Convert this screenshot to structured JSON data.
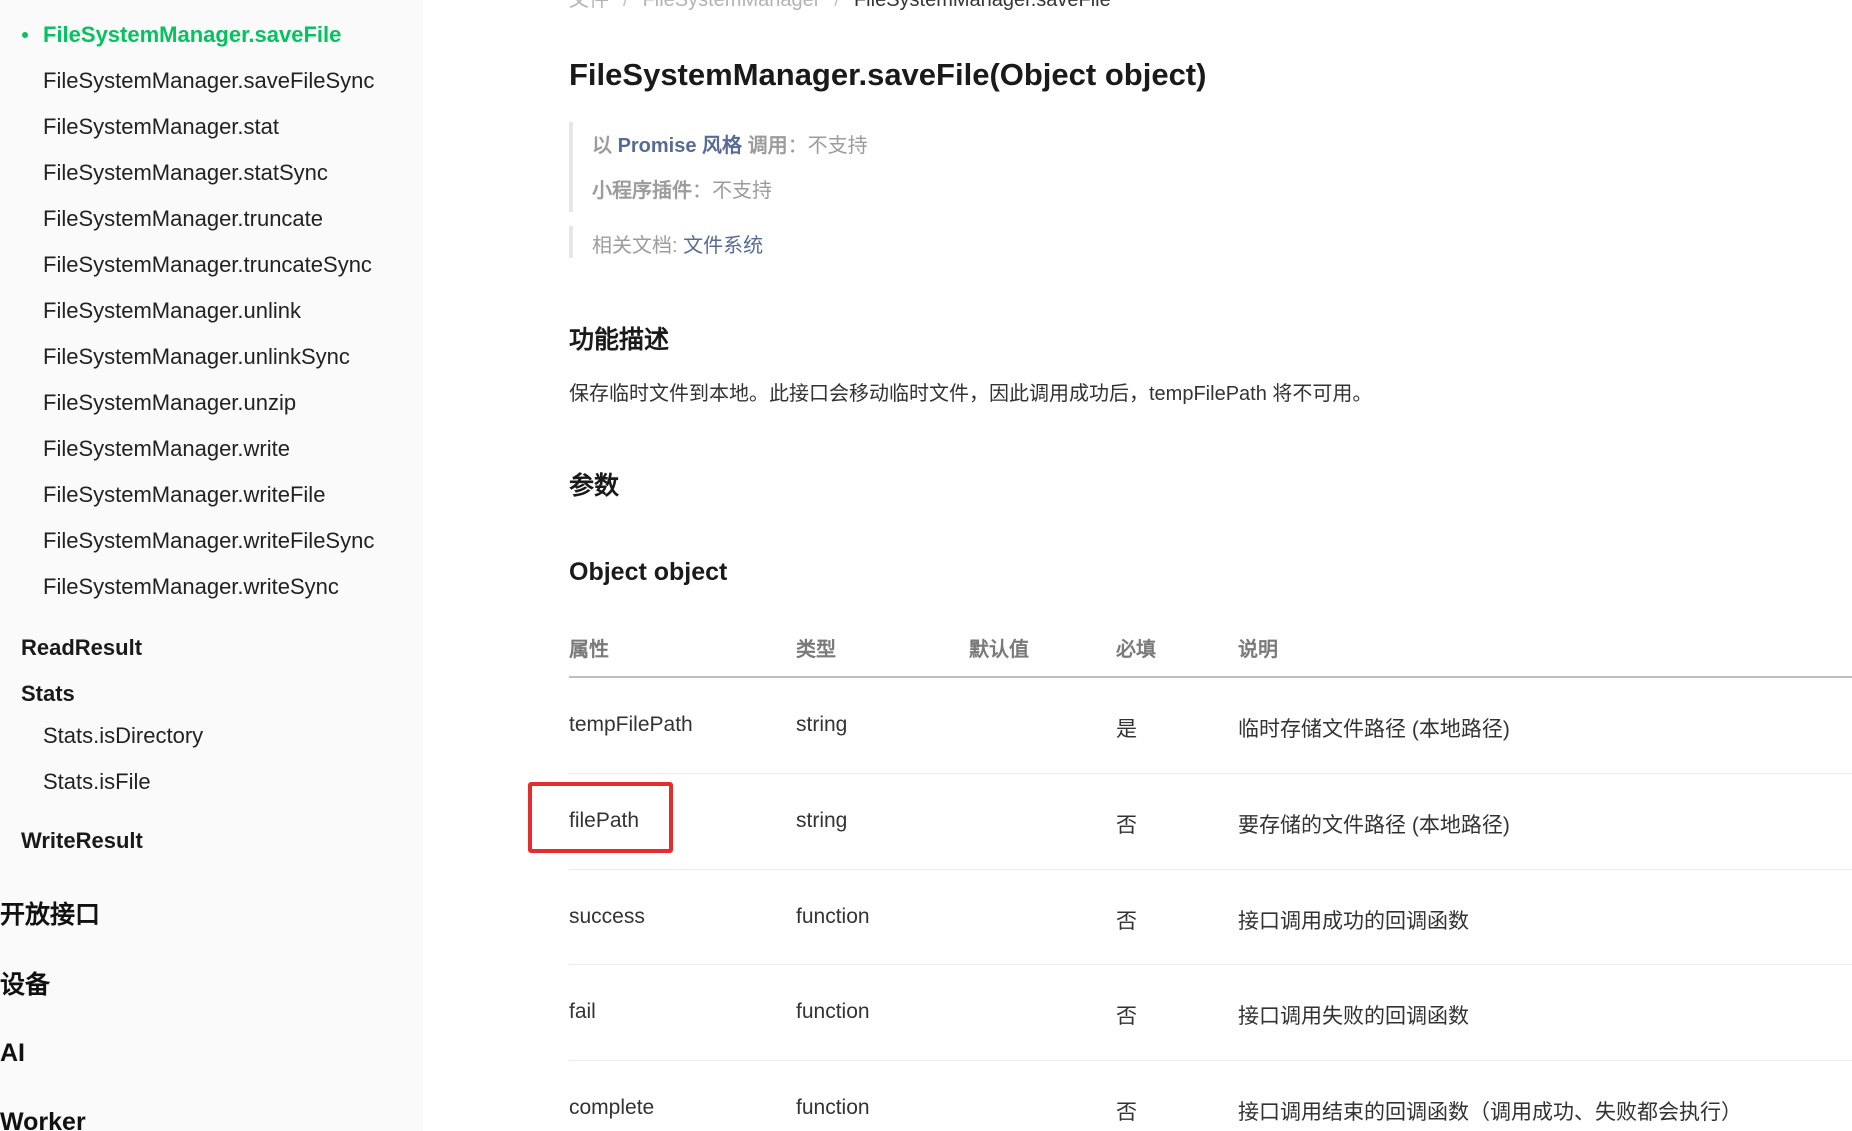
{
  "sidebar": {
    "items": [
      {
        "label": "FileSystemManager.saveFile",
        "active": true
      },
      {
        "label": "FileSystemManager.saveFileSync"
      },
      {
        "label": "FileSystemManager.stat"
      },
      {
        "label": "FileSystemManager.statSync"
      },
      {
        "label": "FileSystemManager.truncate"
      },
      {
        "label": "FileSystemManager.truncateSync"
      },
      {
        "label": "FileSystemManager.unlink"
      },
      {
        "label": "FileSystemManager.unlinkSync"
      },
      {
        "label": "FileSystemManager.unzip"
      },
      {
        "label": "FileSystemManager.write"
      },
      {
        "label": "FileSystemManager.writeFile"
      },
      {
        "label": "FileSystemManager.writeFileSync"
      },
      {
        "label": "FileSystemManager.writeSync"
      }
    ],
    "groups": {
      "read_result": "ReadResult",
      "stats": "Stats",
      "stats_is_directory": "Stats.isDirectory",
      "stats_is_file": "Stats.isFile",
      "write_result": "WriteResult"
    },
    "top_sections": {
      "open_api": "开放接口",
      "device": "设备",
      "ai": "AI",
      "worker": "Worker"
    }
  },
  "breadcrumb": {
    "items": [
      "文件",
      "FileSystemManager",
      "FileSystemManager.saveFile"
    ],
    "separator": "/"
  },
  "page": {
    "title": "FileSystemManager.saveFile(Object object)"
  },
  "notes": {
    "promise_prefix": "以 ",
    "promise_word": "Promise",
    "promise_style": " 风格",
    "promise_call": " 调用",
    "promise_colon": "：",
    "promise_value": "不支持",
    "plugin_label": "小程序插件",
    "plugin_colon": "：",
    "plugin_value": "不支持",
    "related_label": "相关文档: ",
    "related_link": "文件系统"
  },
  "sections": {
    "feature_heading": "功能描述",
    "feature_desc": "保存临时文件到本地。此接口会移动临时文件，因此调用成功后，tempFilePath 将不可用。",
    "params_heading": "参数",
    "object_heading": "Object object"
  },
  "params_table": {
    "headers": {
      "property": "属性",
      "type": "类型",
      "default": "默认值",
      "required": "必填",
      "desc": "说明"
    },
    "rows": [
      {
        "property": "tempFilePath",
        "type": "string",
        "default": "",
        "required": "是",
        "desc": "临时存储文件路径 (本地路径)"
      },
      {
        "property": "filePath",
        "type": "string",
        "default": "",
        "required": "否",
        "desc": "要存储的文件路径 (本地路径)"
      },
      {
        "property": "success",
        "type": "function",
        "default": "",
        "required": "否",
        "desc": "接口调用成功的回调函数"
      },
      {
        "property": "fail",
        "type": "function",
        "default": "",
        "required": "否",
        "desc": "接口调用失败的回调函数"
      },
      {
        "property": "complete",
        "type": "function",
        "default": "",
        "required": "否",
        "desc": "接口调用结束的回调函数（调用成功、失败都会执行）"
      }
    ]
  },
  "colors": {
    "accent_green": "#07c160",
    "link_blue": "#576b95",
    "highlight_red": "#e52d2d"
  }
}
